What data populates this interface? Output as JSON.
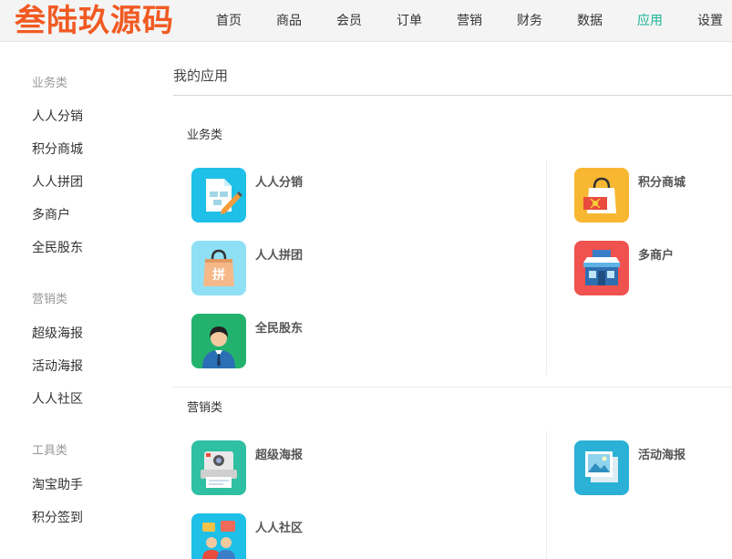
{
  "header": {
    "logo_text": "叁陆玖源码",
    "nav": [
      "首页",
      "商品",
      "会员",
      "订单",
      "营销",
      "财务",
      "数据",
      "应用",
      "设置"
    ],
    "active_nav": "应用"
  },
  "sidebar": {
    "groups": [
      {
        "title": "业务类",
        "items": [
          "人人分销",
          "积分商城",
          "人人拼团",
          "多商户",
          "全民股东"
        ]
      },
      {
        "title": "营销类",
        "items": [
          "超级海报",
          "活动海报",
          "人人社区"
        ]
      },
      {
        "title": "工具类",
        "items": [
          "淘宝助手",
          "积分签到"
        ]
      }
    ]
  },
  "main": {
    "title": "我的应用",
    "sections": [
      {
        "title": "业务类",
        "apps": [
          {
            "label": "人人分销",
            "icon": "distribution-icon",
            "color": "#1ec0e8"
          },
          {
            "label": "积分商城",
            "icon": "shopping-bag-icon",
            "color": "#f7b731"
          },
          {
            "label": "人人拼团",
            "icon": "group-buy-bag-icon",
            "color": "#8fe0f5"
          },
          {
            "label": "多商户",
            "icon": "store-icon",
            "color": "#f0524f"
          },
          {
            "label": "全民股东",
            "icon": "shareholder-icon",
            "color": "#23b26d"
          }
        ]
      },
      {
        "title": "营销类",
        "apps": [
          {
            "label": "超级海报",
            "icon": "poster-printer-icon",
            "color": "#2fbfa2"
          },
          {
            "label": "活动海报",
            "icon": "picture-icon",
            "color": "#2bb0d6"
          },
          {
            "label": "人人社区",
            "icon": "community-icon",
            "color": "#1ec0e8"
          }
        ]
      }
    ]
  }
}
